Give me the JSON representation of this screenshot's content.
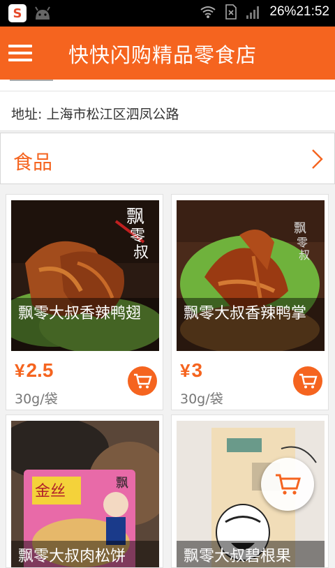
{
  "status_bar": {
    "app_badge": "S",
    "battery": "26%",
    "time": "21:52",
    "icons": [
      "sogou-icon",
      "android-icon",
      "wifi-icon",
      "sim-icon",
      "signal-icon"
    ]
  },
  "header": {
    "title": "快快闪购精品零食店",
    "menu_icon": "hamburger-menu-icon"
  },
  "address": {
    "text": "地址: 上海市松江区泗凤公路"
  },
  "category": {
    "label": "食品",
    "icon": "chevron-right-icon"
  },
  "products": [
    {
      "name": "飘零大叔香辣鸭翅",
      "price": "2.5",
      "currency": "¥",
      "unit": "30g/袋",
      "cart_icon": "cart-icon"
    },
    {
      "name": "飘零大叔香辣鸭掌",
      "price": "3",
      "currency": "¥",
      "unit": "30g/袋",
      "cart_icon": "cart-icon"
    },
    {
      "name": "飘零大叔肉松饼",
      "price": "",
      "currency": "",
      "unit": "",
      "cart_icon": ""
    },
    {
      "name": "飘零大叔碧根果",
      "price": "",
      "currency": "",
      "unit": "",
      "cart_icon": ""
    }
  ],
  "floating_cart": {
    "icon": "cart-icon"
  },
  "colors": {
    "accent": "#f5641f",
    "status_bar": "#000000"
  }
}
